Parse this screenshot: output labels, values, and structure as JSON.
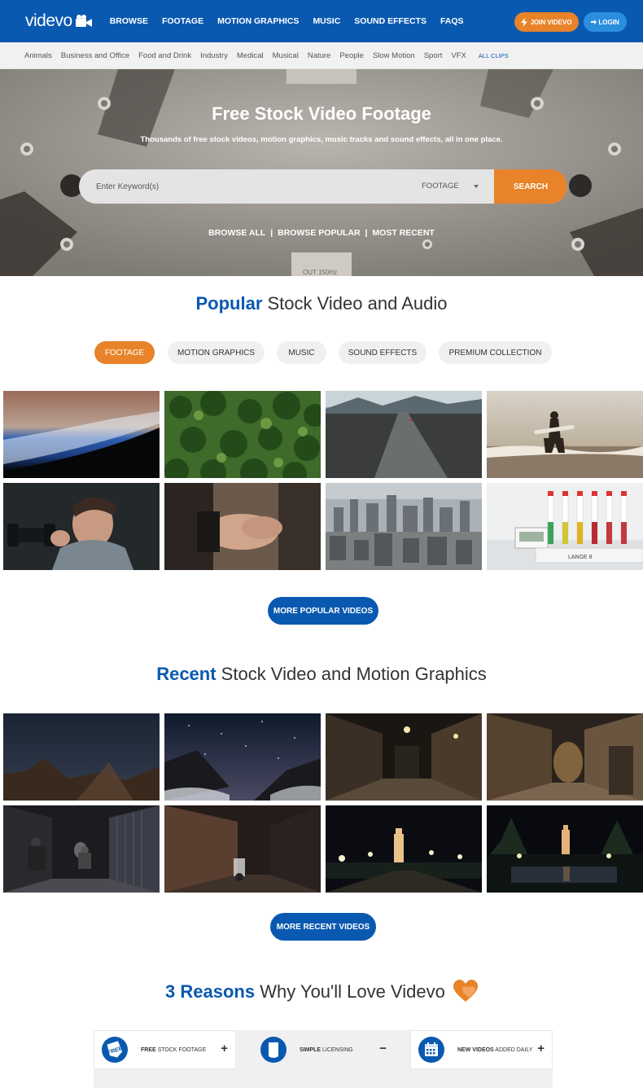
{
  "nav": {
    "logo": "videvo",
    "links": [
      "BROWSE",
      "FOOTAGE",
      "MOTION GRAPHICS",
      "MUSIC",
      "SOUND EFFECTS",
      "FAQS"
    ],
    "join": "JOIN VIDEVO",
    "login": "LOGIN"
  },
  "categories": [
    "Animals",
    "Business and Office",
    "Food and Drink",
    "Industry",
    "Medical",
    "Musical",
    "Nature",
    "People",
    "Slow Motion",
    "Sport",
    "VFX"
  ],
  "all_clips": "ALL CLIPS",
  "hero": {
    "title": "Free Stock Video Footage",
    "subtitle": "Thousands of free stock videos, motion graphics, music tracks and sound effects, all in one place.",
    "search_placeholder": "Enter Keyword(s)",
    "search_type": "FOOTAGE",
    "search_button": "SEARCH",
    "links": [
      "BROWSE ALL",
      "BROWSE POPULAR",
      "MOST RECENT"
    ],
    "reel_text": "OUT 150Hz"
  },
  "popular": {
    "title_bold": "Popular",
    "title_rest": " Stock Video and Audio",
    "tabs": [
      "FOOTAGE",
      "MOTION GRAPHICS",
      "MUSIC",
      "SOUND EFFECTS",
      "PREMIUM COLLECTION"
    ],
    "more": "MORE POPULAR VIDEOS"
  },
  "recent": {
    "title_bold": "Recent",
    "title_rest": " Stock Video and Motion Graphics",
    "more": "MORE RECENT VIDEOS"
  },
  "reasons": {
    "title_bold": "3 Reasons",
    "title_rest": " Why You'll Love Videvo",
    "items": [
      {
        "bold": "FREE",
        "rest": " STOCK FOOTAGE",
        "sign": "+",
        "icon_text": "FREE"
      },
      {
        "bold": "SIMPLE",
        "rest": " LICENSING",
        "sign": "−",
        "icon_text": ""
      },
      {
        "bold": "NEW VIDEOS",
        "rest": " ADDED DAILY",
        "sign": "+",
        "icon_text": ""
      }
    ]
  },
  "thumb_labels": {
    "lab_display": "LANGE 8"
  },
  "colors": {
    "brand_blue": "#0a59b0",
    "accent_orange": "#e8832a",
    "login_blue": "#2b8fe0"
  }
}
